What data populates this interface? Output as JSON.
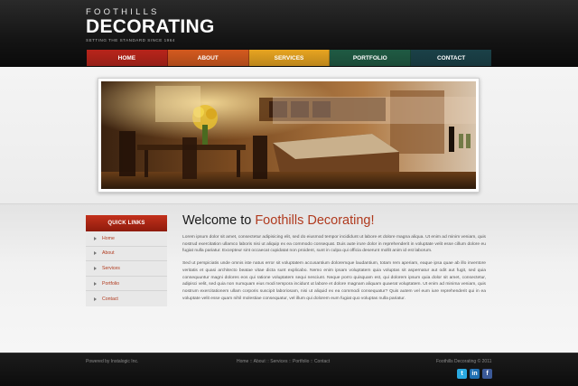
{
  "logo": {
    "top": "FOOTHILLS",
    "main": "DECORATING",
    "tagline": "SETTING THE STANDARD SINCE 1964"
  },
  "nav": [
    {
      "label": "HOME",
      "color": "#b8241a"
    },
    {
      "label": "ABOUT",
      "color": "#d45a1e"
    },
    {
      "label": "SERVICES",
      "color": "#e7a420"
    },
    {
      "label": "PORTFOLIO",
      "color": "#1f5b43"
    },
    {
      "label": "CONTACT",
      "color": "#1a4148"
    }
  ],
  "quick_links": {
    "heading": "QUICK LINKS",
    "items": [
      "Home",
      "About",
      "Services",
      "Portfolio",
      "Contact"
    ]
  },
  "main": {
    "welcome_prefix": "Welcome to ",
    "welcome_name": "Foothills Decorating!",
    "para1": "Lorem ipsum dolor sit amet, consectetur adipisicing elit, sed do eiusmod tempor incididunt ut labore et dolore magna aliqua. Ut enim ad minim veniam, quis nostrud exercitation ullamco laboris nisi ut aliquip ex ea commodo consequat. Duis aute irure dolor in reprehenderit in voluptate velit esse cillum dolore eu fugiat nulla pariatur. Excepteur sint occaecat cupidatat non proident, sunt in culpa qui officia deserunt mollit anim id est laborum.",
    "para2": "Sed ut perspiciatis unde omnis iste natus error sit voluptatem accusantium doloremque laudantium, totam rem aperiam, eaque ipsa quae ab illo inventore veritatis et quasi architecto beatae vitae dicta sunt explicabo. Nemo enim ipsam voluptatem quia voluptas sit aspernatur aut odit aut fugit, sed quia consequuntur magni dolores eos qui ratione voluptatem sequi nesciunt. Neque porro quisquam est, qui dolorem ipsum quia dolor sit amet, consectetur, adipisci velit, sed quia non numquam eius modi tempora incidunt ut labore et dolore magnam aliquam quaerat voluptatem. Ut enim ad minima veniam, quis nostrum exercitationem ullam corporis suscipit laboriosam, nisi ut aliquid ex ea commodi consequatur? Quis autem vel eum iure reprehenderit qui in ea voluptate velit esse quam nihil molestiae consequatur, vel illum qui dolorem eum fugiat quo voluptas nulla pariatur."
  },
  "footer": {
    "powered": "Powered by Instalogic Inc.",
    "links": [
      "Home",
      "About",
      "Services",
      "Portfolio",
      "Contact"
    ],
    "separator": "::",
    "copyright": "Foothills Decorating © 2011",
    "social": [
      {
        "icon": "twitter-icon",
        "glyph": "t",
        "color": "#2aa9e0"
      },
      {
        "icon": "linkedin-icon",
        "glyph": "in",
        "color": "#1f6fb2"
      },
      {
        "icon": "facebook-icon",
        "glyph": "f",
        "color": "#3b5998"
      }
    ]
  }
}
